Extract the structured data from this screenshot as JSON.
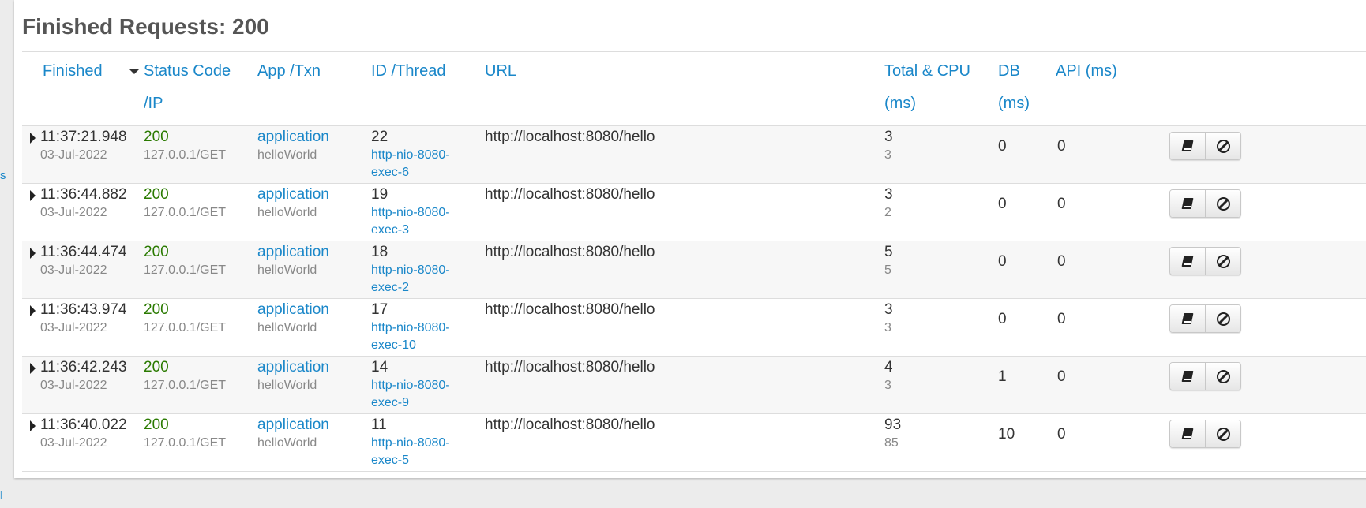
{
  "side_stub": "s",
  "title": "Finished Requests: 200",
  "columns": {
    "finished": "Finished",
    "status_1": "Status Code",
    "status_2": "/IP",
    "app": "App /Txn",
    "id": "ID /Thread",
    "url": "URL",
    "total_1": "Total & CPU",
    "total_2": "(ms)",
    "db_1": "DB",
    "db_2": "(ms)",
    "api": "API (ms)"
  },
  "rows": [
    {
      "time": "11:37:21.948",
      "date": "03-Jul-2022",
      "status": "200",
      "ip": "127.0.0.1/GET",
      "app": "application",
      "txn": "helloWorld",
      "id": "22",
      "thread_1": "http-nio-8080-",
      "thread_2": "exec-6",
      "url": "http://localhost:8080/hello",
      "total": "3",
      "cpu": "3",
      "db": "0",
      "api": "0"
    },
    {
      "time": "11:36:44.882",
      "date": "03-Jul-2022",
      "status": "200",
      "ip": "127.0.0.1/GET",
      "app": "application",
      "txn": "helloWorld",
      "id": "19",
      "thread_1": "http-nio-8080-",
      "thread_2": "exec-3",
      "url": "http://localhost:8080/hello",
      "total": "3",
      "cpu": "2",
      "db": "0",
      "api": "0"
    },
    {
      "time": "11:36:44.474",
      "date": "03-Jul-2022",
      "status": "200",
      "ip": "127.0.0.1/GET",
      "app": "application",
      "txn": "helloWorld",
      "id": "18",
      "thread_1": "http-nio-8080-",
      "thread_2": "exec-2",
      "url": "http://localhost:8080/hello",
      "total": "5",
      "cpu": "5",
      "db": "0",
      "api": "0"
    },
    {
      "time": "11:36:43.974",
      "date": "03-Jul-2022",
      "status": "200",
      "ip": "127.0.0.1/GET",
      "app": "application",
      "txn": "helloWorld",
      "id": "17",
      "thread_1": "http-nio-8080-",
      "thread_2": "exec-10",
      "url": "http://localhost:8080/hello",
      "total": "3",
      "cpu": "3",
      "db": "0",
      "api": "0"
    },
    {
      "time": "11:36:42.243",
      "date": "03-Jul-2022",
      "status": "200",
      "ip": "127.0.0.1/GET",
      "app": "application",
      "txn": "helloWorld",
      "id": "14",
      "thread_1": "http-nio-8080-",
      "thread_2": "exec-9",
      "url": "http://localhost:8080/hello",
      "total": "4",
      "cpu": "3",
      "db": "1",
      "api": "0"
    },
    {
      "time": "11:36:40.022",
      "date": "03-Jul-2022",
      "status": "200",
      "ip": "127.0.0.1/GET",
      "app": "application",
      "txn": "helloWorld",
      "id": "11",
      "thread_1": "http-nio-8080-",
      "thread_2": "exec-5",
      "url": "http://localhost:8080/hello",
      "total": "93",
      "cpu": "85",
      "db": "10",
      "api": "0"
    }
  ],
  "icons": {
    "details": "book-icon",
    "cancel": "cancel-icon",
    "expand": "caret-right-icon",
    "sort": "caret-down-icon"
  },
  "colors": {
    "link": "#1a87c9",
    "status_ok": "#2a7a00",
    "title": "#555555"
  }
}
